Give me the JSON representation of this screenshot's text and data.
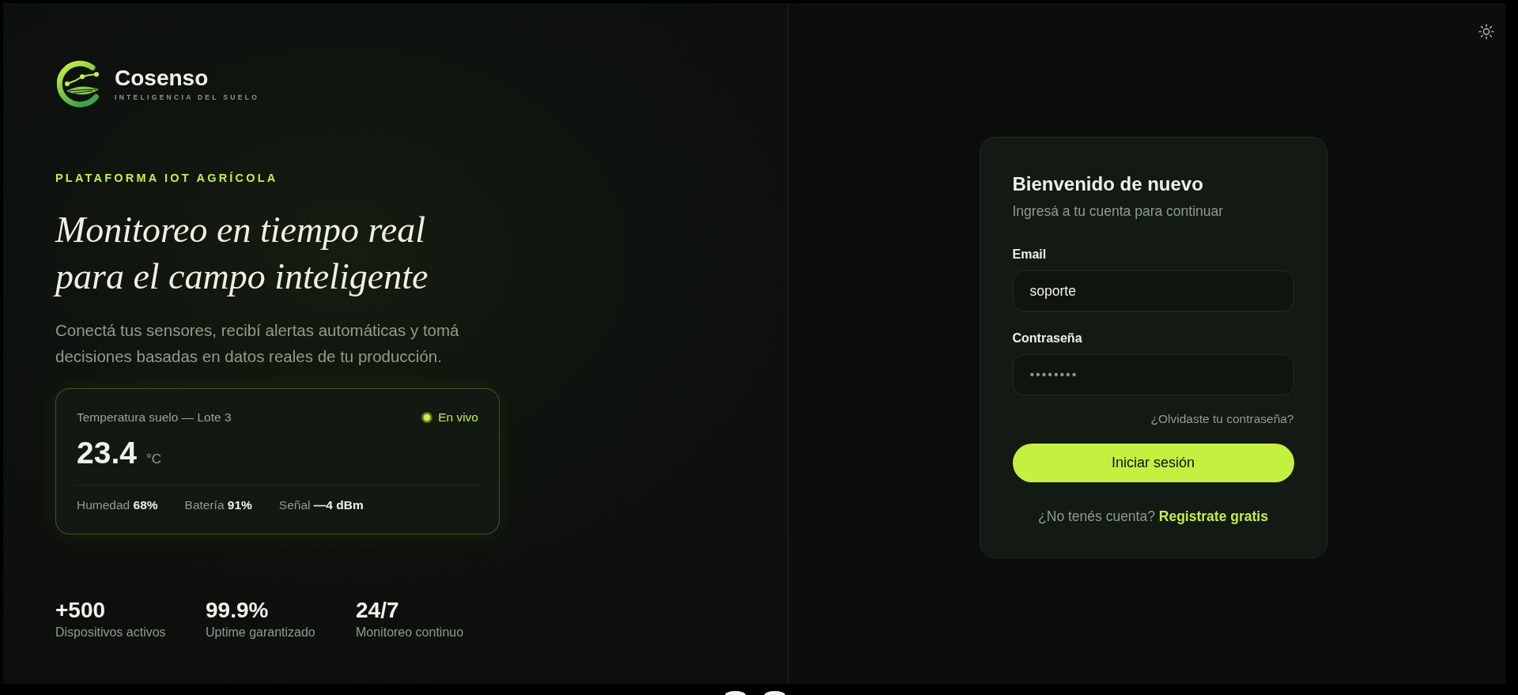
{
  "brand": {
    "name": "Cosenso",
    "tagline": "INTELIGENCIA DEL SUELO"
  },
  "hero": {
    "eyebrow": "PLATAFORMA IOT AGRÍCOLA",
    "headline": [
      "Monitoreo en tiempo real",
      "para el campo inteligente"
    ],
    "description": [
      "Conectá tus sensores, recibí alertas automáticas y tomá",
      "decisiones basadas en datos reales de tu producción."
    ]
  },
  "sensor_card": {
    "title": "Temperatura suelo — Lote 3",
    "status": "En vivo",
    "value": "23.4",
    "unit": "°C",
    "metrics": [
      "Humedad **68%**",
      "Batería **91%**",
      "Señal **—4 dBm**"
    ]
  },
  "stats": [
    {
      "value": "+500",
      "label": "Dispositivos activos"
    },
    {
      "value": "99.9%",
      "label": "Uptime garantizado"
    },
    {
      "value": "24/7",
      "label": "Monitoreo continuo"
    }
  ],
  "login": {
    "title": "Bienvenido de nuevo",
    "subtitle": "Ingresá a tu cuenta para continuar",
    "fields": [
      {
        "kind": "email",
        "label": "Email",
        "value": "soporte"
      },
      {
        "kind": "password",
        "label": "Contraseña",
        "value": "••••••••"
      }
    ],
    "forgot_link": "¿Olvidaste tu contraseña?",
    "submit": "Iniciar sesión",
    "signup_prompt": "¿No tenés cuenta?",
    "signup_link": "Registrate gratis"
  }
}
